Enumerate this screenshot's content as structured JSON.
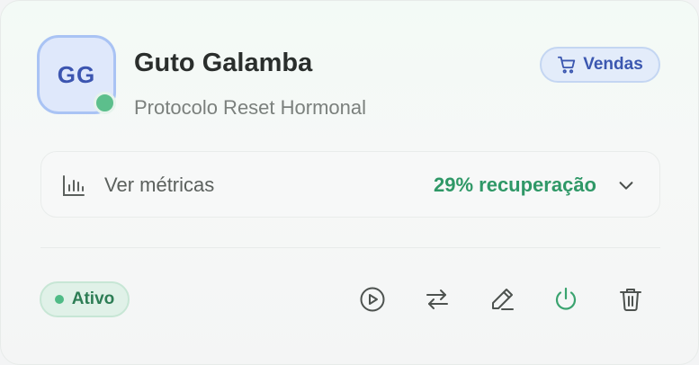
{
  "profile": {
    "initials": "GG",
    "name": "Guto Galamba",
    "protocol": "Protocolo Reset Hormonal"
  },
  "sales_badge": {
    "label": "Vendas",
    "icon": "cart-icon"
  },
  "metrics": {
    "label": "Ver métricas",
    "value": "29% recuperação",
    "icon": "bar-chart-icon"
  },
  "status": {
    "label": "Ativo",
    "color": "#4fbb86"
  },
  "actions": [
    {
      "name": "play-icon"
    },
    {
      "name": "swap-icon"
    },
    {
      "name": "edit-icon"
    },
    {
      "name": "power-icon",
      "color": "#3aa36f"
    },
    {
      "name": "trash-icon"
    }
  ],
  "colors": {
    "accent_green": "#2f9867",
    "accent_blue": "#3b57b0",
    "text_dark": "#2a2e2c"
  }
}
